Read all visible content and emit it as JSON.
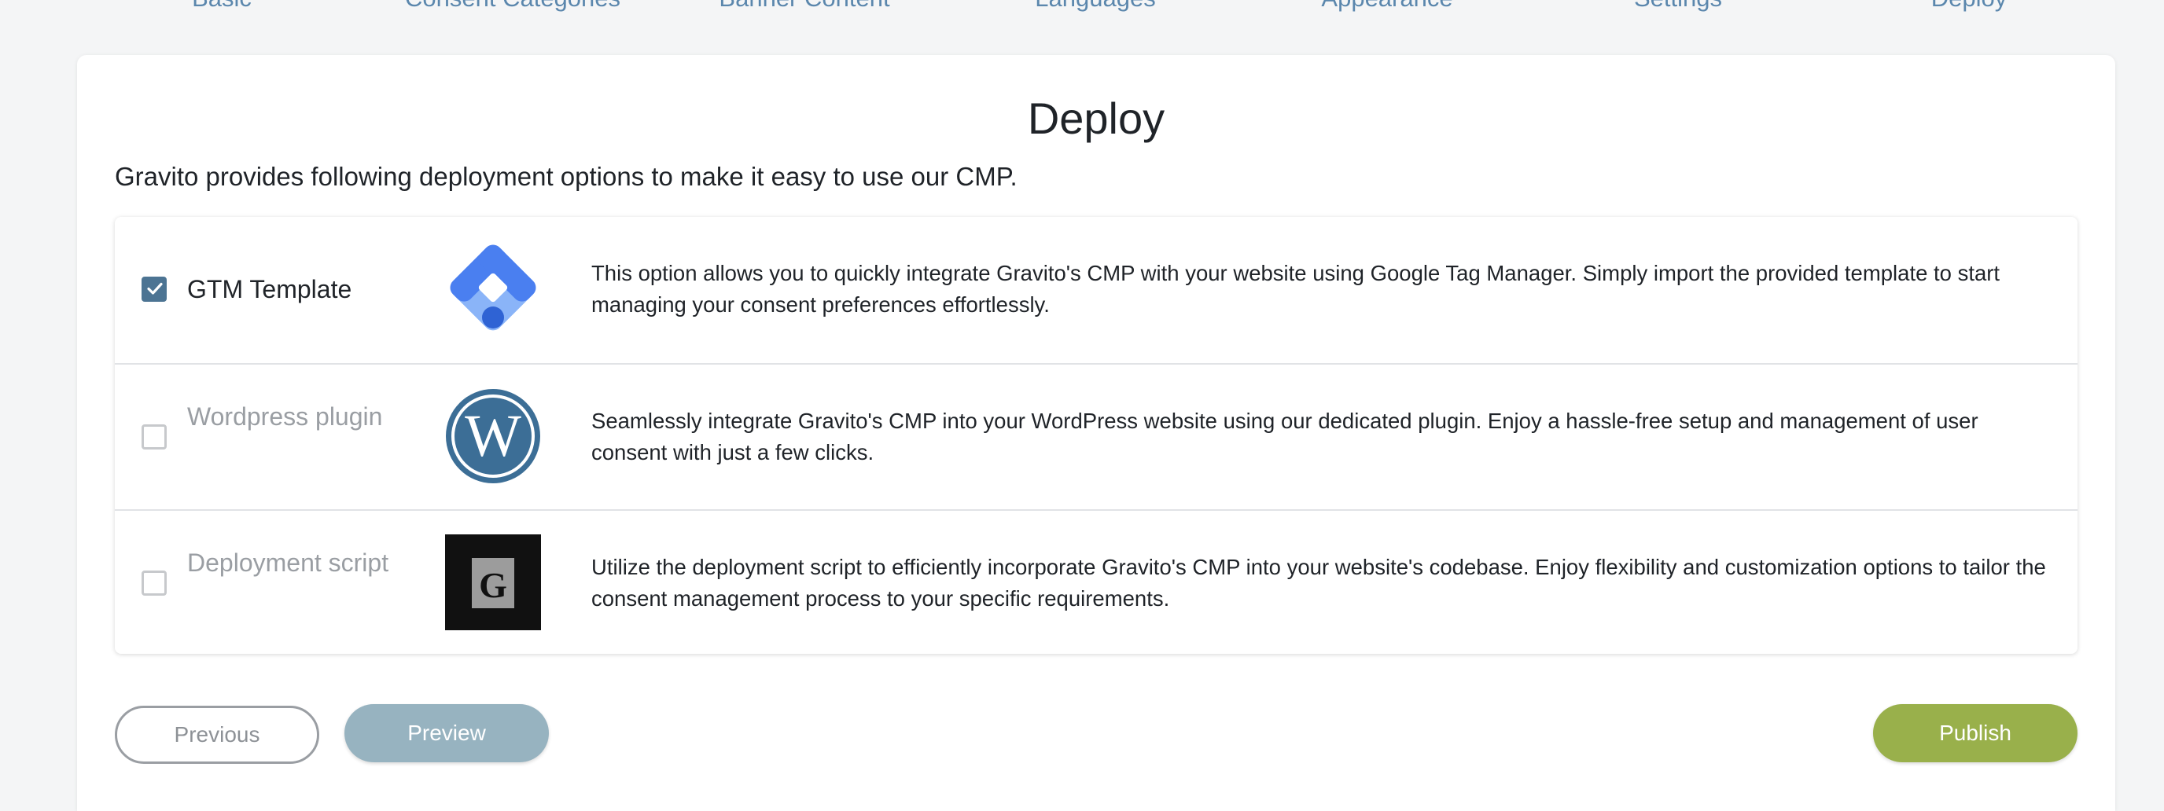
{
  "stepper": {
    "steps": [
      "Basic",
      "Consent Categories",
      "Banner Content",
      "Languages",
      "Appearance",
      "Settings",
      "Deploy"
    ]
  },
  "page": {
    "title": "Deploy",
    "intro": "Gravito provides following deployment options to make it easy to use our CMP."
  },
  "options": [
    {
      "label": "GTM Template",
      "checked": true,
      "icon": "google-tag-manager-logo",
      "description": "This option allows you to quickly integrate Gravito's CMP with your website using Google Tag Manager. Simply import the provided template to start managing your consent preferences effortlessly."
    },
    {
      "label": "Wordpress plugin",
      "checked": false,
      "icon": "wordpress-logo",
      "description": "Seamlessly integrate Gravito's CMP into your WordPress website using our dedicated plugin. Enjoy a hassle-free setup and management of user consent with just a few clicks."
    },
    {
      "label": "Deployment script",
      "checked": false,
      "icon": "gravito-script-logo",
      "description": "Utilize the deployment script to efficiently incorporate Gravito's CMP into your website's codebase. Enjoy flexibility and customization options to tailor the consent management process to your specific requirements."
    }
  ],
  "buttons": {
    "previous": "Previous",
    "preview": "Preview",
    "publish": "Publish"
  },
  "colors": {
    "step_link": "#5b87ad",
    "checkbox_checked": "#4c7493",
    "preview_button": "#97b3c0",
    "publish_button": "#99b04b",
    "wordpress_blue": "#3c6e96",
    "gtm_blue": "#4a7ff0"
  }
}
